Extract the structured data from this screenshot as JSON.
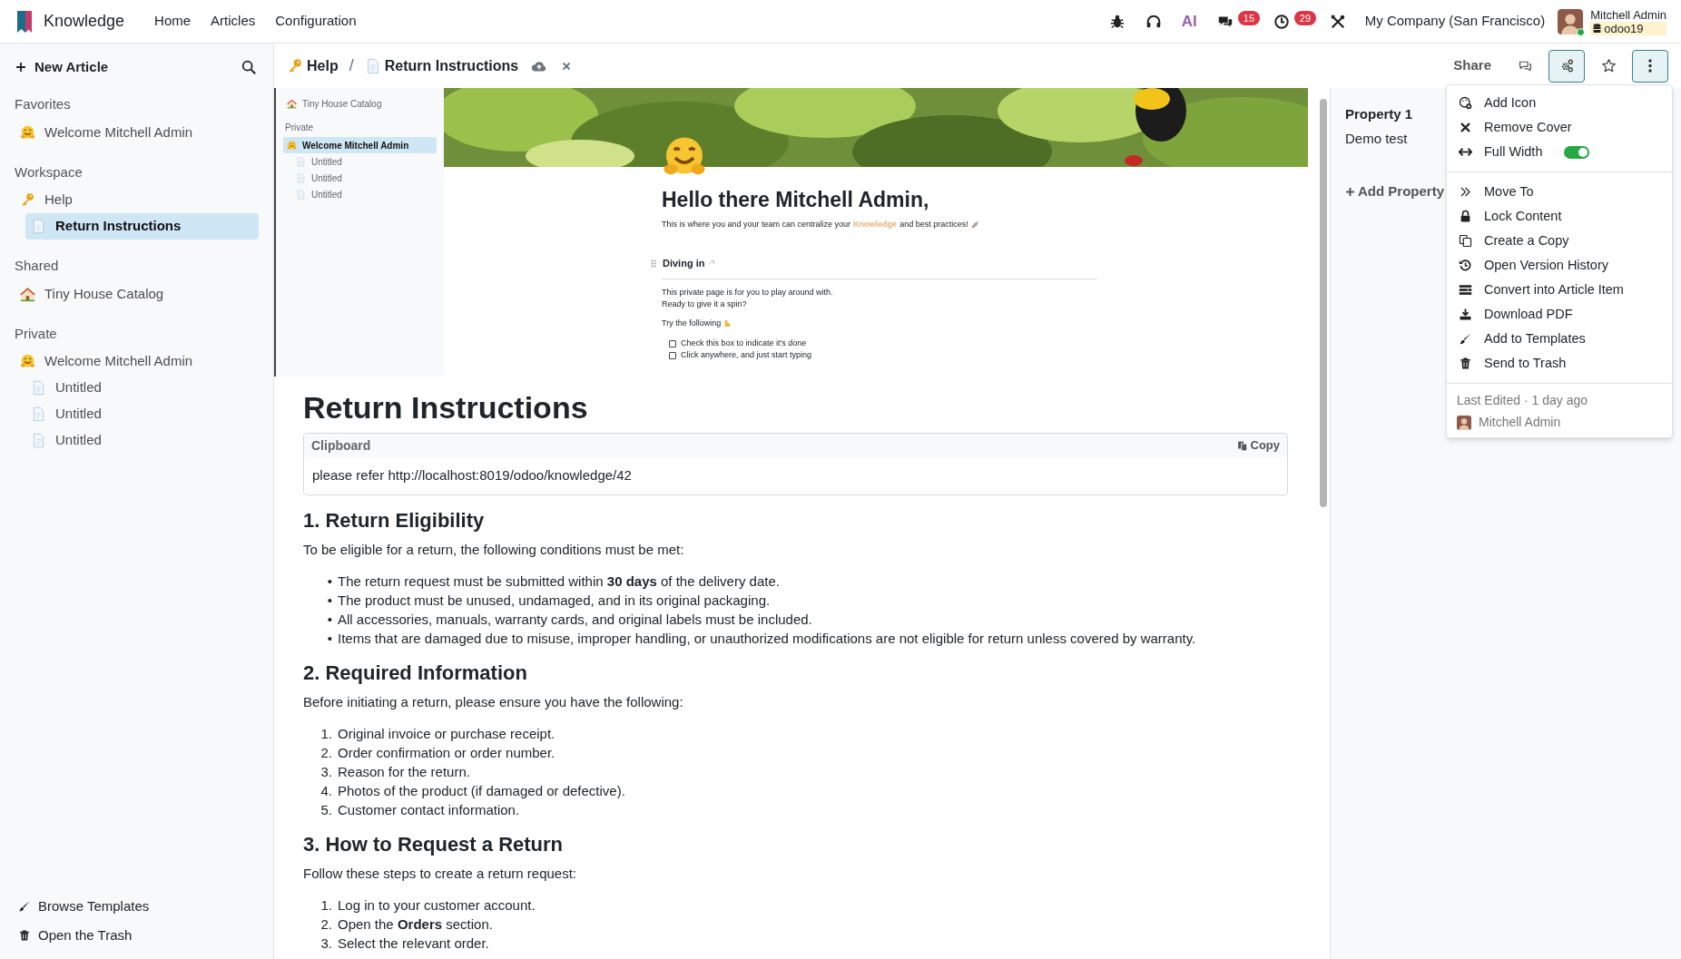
{
  "topbar": {
    "app_name": "Knowledge",
    "menu": [
      "Home",
      "Articles",
      "Configuration"
    ],
    "systray": [
      {
        "kind": "bug"
      },
      {
        "kind": "headset"
      },
      {
        "kind": "ai",
        "label": "AI"
      },
      {
        "kind": "chat",
        "badge": "15"
      },
      {
        "kind": "clock",
        "badge": "29"
      },
      {
        "kind": "tools"
      }
    ],
    "company": "My Company (San Francisco)",
    "user": {
      "name": "Mitchell Admin",
      "database": "odoo19",
      "online": true
    }
  },
  "sidebar": {
    "new_article": "New Article",
    "sections": [
      {
        "title": "Favorites",
        "items": [
          {
            "label": "Welcome Mitchell Admin",
            "kind": "hug",
            "selected": false
          }
        ]
      },
      {
        "title": "Workspace",
        "items": [
          {
            "label": "Help",
            "kind": "key",
            "selected": false,
            "children": [
              {
                "label": "Return Instructions",
                "kind": "page",
                "selected": true
              }
            ]
          }
        ]
      },
      {
        "title": "Shared",
        "items": [
          {
            "label": "Tiny House Catalog",
            "kind": "house",
            "selected": false
          }
        ]
      },
      {
        "title": "Private",
        "items": [
          {
            "label": "Welcome Mitchell Admin",
            "kind": "hug",
            "selected": false,
            "children": [
              {
                "label": "Untitled",
                "kind": "page",
                "selected": false
              },
              {
                "label": "Untitled",
                "kind": "page",
                "selected": false
              },
              {
                "label": "Untitled",
                "kind": "page",
                "selected": false
              }
            ]
          }
        ]
      }
    ],
    "footer": [
      {
        "kind": "brush",
        "label": "Browse Templates"
      },
      {
        "kind": "trash",
        "label": "Open the Trash"
      }
    ]
  },
  "breadcrumb": {
    "items": [
      {
        "label": "Help",
        "kind": "key"
      },
      {
        "label": "Return Instructions",
        "kind": "page"
      }
    ],
    "separator": "/"
  },
  "actions": [
    {
      "kind": "share",
      "label": "Share",
      "selected": false
    },
    {
      "kind": "chat",
      "selected": false
    },
    {
      "kind": "properties",
      "selected": true
    },
    {
      "kind": "favorite",
      "selected": false
    },
    {
      "kind": "more",
      "selected": true
    }
  ],
  "embedded_screenshot": {
    "sidebar": [
      {
        "label": "Tiny House Catalog",
        "kind": "house",
        "selected": false
      },
      {
        "section": "Private"
      },
      {
        "label": "Welcome Mitchell Admin",
        "kind": "hug",
        "selected": true,
        "children": [
          {
            "label": "Untitled",
            "kind": "page",
            "selected": false
          },
          {
            "label": "Untitled",
            "kind": "page",
            "selected": false
          },
          {
            "label": "Untitled",
            "kind": "page",
            "selected": false
          }
        ]
      }
    ],
    "title": "Hello there Mitchell Admin,",
    "intro": {
      "before": "This is where you and your team can centralize your",
      "link": "Knowledge",
      "after": "and best practices!"
    },
    "heading": "Diving in",
    "paragraph": [
      "This private page is for you to play around with.",
      "Ready to give it a spin?"
    ],
    "try": "Try the following",
    "checklist": [
      {
        "label": "Check this box to indicate it's done",
        "checked": false
      },
      {
        "label": "Click anywhere, and just start typing",
        "checked": false
      }
    ]
  },
  "article": {
    "title": "Return Instructions",
    "clipboard": {
      "label": "Clipboard",
      "copy": "Copy",
      "content": "please refer http://localhost:8019/odoo/knowledge/42"
    },
    "blocks": [
      {
        "kind": "h2",
        "text": "1. Return Eligibility"
      },
      {
        "kind": "p",
        "text": "To be eligible for a return, the following conditions must be met:"
      },
      {
        "kind": "ul",
        "items": [
          {
            "marker": "•",
            "text": "The return request must be submitted within **30 days** of the delivery date."
          },
          {
            "marker": "•",
            "text": "The product must be unused, undamaged, and in its original packaging."
          },
          {
            "marker": "•",
            "text": "All accessories, manuals, warranty cards, and original labels must be included."
          },
          {
            "marker": "•",
            "text": "Items that are damaged due to misuse, improper handling, or unauthorized modifications are not eligible for return unless covered by warranty."
          }
        ]
      },
      {
        "kind": "h2",
        "text": "2. Required Information"
      },
      {
        "kind": "p",
        "text": "Before initiating a return, please ensure you have the following:"
      },
      {
        "kind": "ol",
        "items": [
          {
            "marker": "1.",
            "text": "Original invoice or purchase receipt."
          },
          {
            "marker": "2.",
            "text": "Order confirmation or order number."
          },
          {
            "marker": "3.",
            "text": "Reason for the return."
          },
          {
            "marker": "4.",
            "text": "Photos of the product (if damaged or defective)."
          },
          {
            "marker": "5.",
            "text": "Customer contact information."
          }
        ]
      },
      {
        "kind": "h2",
        "text": "3. How to Request a Return"
      },
      {
        "kind": "p",
        "text": "Follow these steps to create a return request:"
      },
      {
        "kind": "ol",
        "items": [
          {
            "marker": "1.",
            "text": "Log in to your customer account."
          },
          {
            "marker": "2.",
            "text": "Open the **Orders** section."
          },
          {
            "marker": "3.",
            "text": "Select the relevant order."
          }
        ]
      }
    ]
  },
  "properties": {
    "items": [
      {
        "label": "Property 1",
        "value": "Demo test"
      }
    ],
    "add": "Add Property"
  },
  "menu": {
    "groups": [
      [
        {
          "kind": "add-icon",
          "label": "Add Icon"
        },
        {
          "kind": "remove",
          "label": "Remove Cover"
        },
        {
          "kind": "width",
          "label": "Full Width",
          "on": true
        }
      ],
      [
        {
          "kind": "move",
          "label": "Move To"
        },
        {
          "kind": "lock",
          "label": "Lock Content"
        },
        {
          "kind": "copy",
          "label": "Create a Copy"
        },
        {
          "kind": "history",
          "label": "Open Version History"
        },
        {
          "kind": "convert",
          "label": "Convert into Article Item"
        },
        {
          "kind": "download",
          "label": "Download PDF"
        },
        {
          "kind": "brush",
          "label": "Add to Templates"
        },
        {
          "kind": "trash",
          "label": "Send to Trash"
        }
      ]
    ],
    "last_edited": "Last Edited · 1 day ago",
    "editor": "Mitchell Admin"
  }
}
